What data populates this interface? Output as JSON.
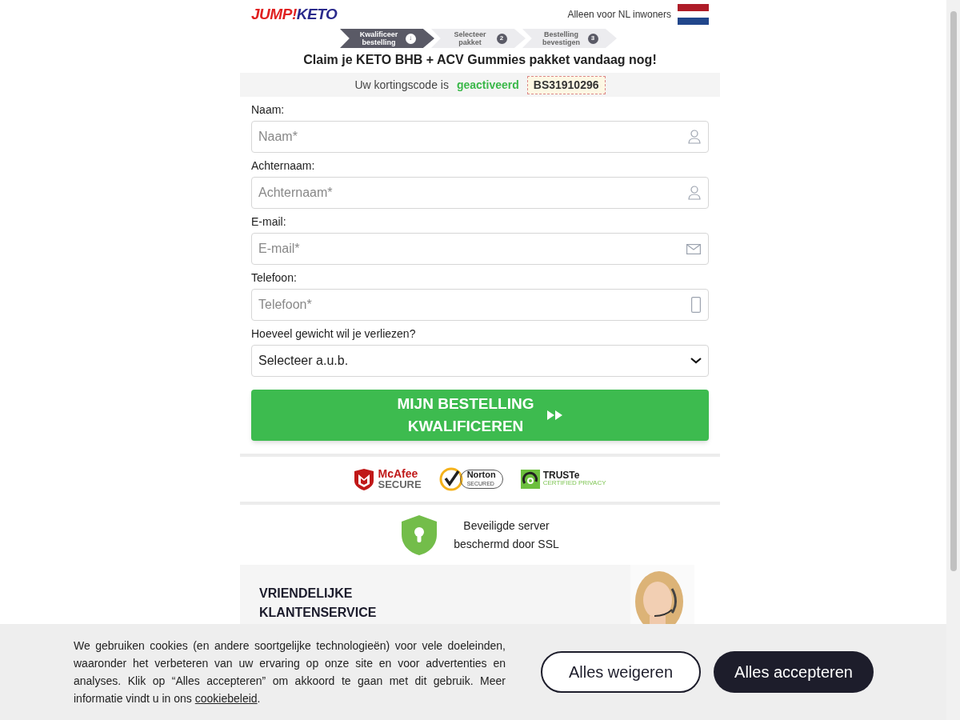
{
  "header": {
    "logo": {
      "part1": "JUMP!",
      "part2": "KETO"
    },
    "region_note": "Alleen voor NL inwoners"
  },
  "steps": [
    {
      "label": "Kwalificeer bestelling",
      "marker": "↓",
      "selected": true
    },
    {
      "label": "Selecteer pakket",
      "marker": "2",
      "selected": false
    },
    {
      "label": "Bestelling bevestigen",
      "marker": "3",
      "selected": false
    }
  ],
  "headline": "Claim je KETO BHB + ACV Gummies pakket vandaag nog!",
  "discount": {
    "text": "Uw kortingscode is",
    "status": "geactiveerd",
    "code": "BS31910296"
  },
  "fields": [
    {
      "label": "Naam:",
      "placeholder": "Naam*",
      "kind": "person"
    },
    {
      "label": "Achternaam:",
      "placeholder": "Achternaam*",
      "kind": "person"
    },
    {
      "label": "E-mail:",
      "placeholder": "E-mail*",
      "kind": "mail"
    },
    {
      "label": "Telefoon:",
      "placeholder": "Telefoon*",
      "kind": "phone"
    },
    {
      "label": "Hoeveel gewicht wil je verliezen?",
      "value": "Selecteer a.u.b.",
      "kind": "select"
    }
  ],
  "submit": {
    "line1": "MIJN BESTELLING",
    "line2": "KWALIFICEREN"
  },
  "badges": [
    {
      "kind": "mcafee",
      "line1": "McAfee",
      "line2": "SECURE"
    },
    {
      "kind": "norton",
      "line1": "Norton",
      "line2": "SECURED"
    },
    {
      "kind": "truste",
      "line1": "TRUSTe",
      "line2": "CERTIFIED PRIVACY"
    }
  ],
  "ssl": {
    "line1": "Beveiligde server",
    "line2": "beschermd door SSL"
  },
  "support": {
    "title_line1": "VRIENDELIJKE",
    "title_line2": "KLANTENSERVICE"
  },
  "cookie_banner": {
    "text": "We gebruiken cookies (en andere soortgelijke technologieën) voor vele doeleinden, waaronder het verbeteren van uw ervaring op onze site en voor advertenties en analyses. Klik op “Alles accepteren” om akkoord te gaan met dit gebruik. Meer informatie vindt u in ons",
    "link": "cookiebeleid",
    "after_link": ".",
    "buttons": [
      {
        "label": "Alles weigeren",
        "kind": "outline"
      },
      {
        "label": "Alles accepteren",
        "kind": "solid"
      }
    ]
  }
}
